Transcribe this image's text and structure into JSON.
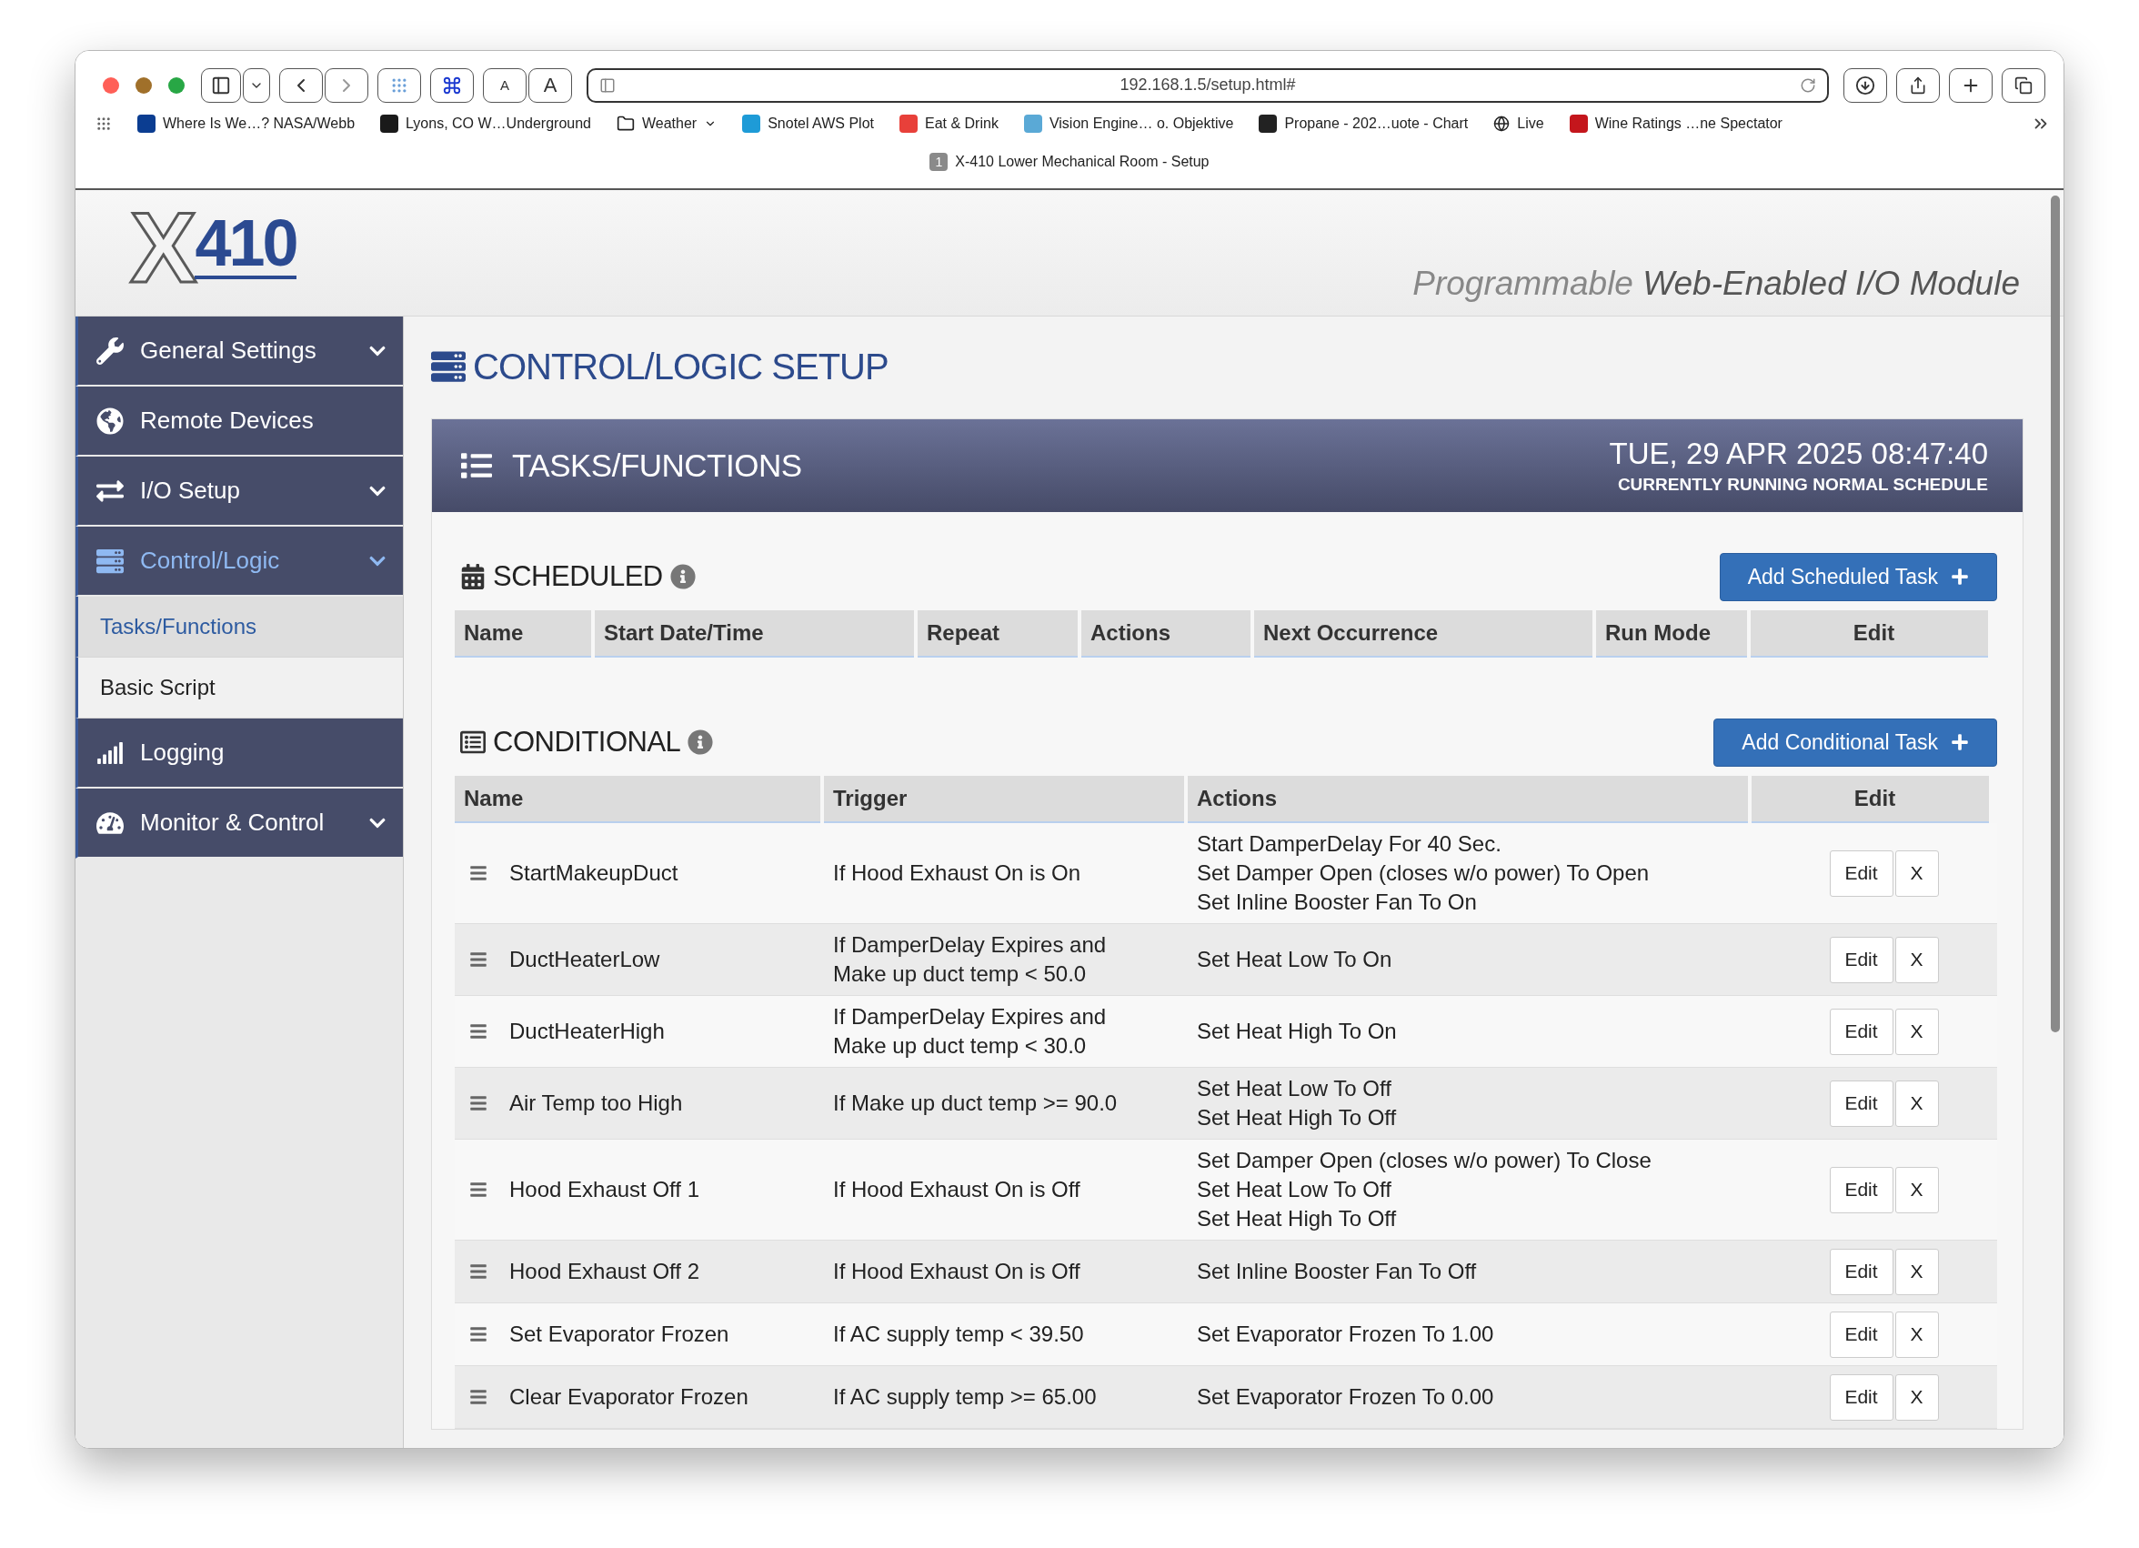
{
  "browser": {
    "text_size_buttons": [
      "A",
      "A"
    ],
    "url": "192.168.1.5/setup.html#",
    "bookmarks": [
      {
        "label": "Where Is We…? NASA/Webb",
        "kind": "link"
      },
      {
        "label": "Lyons, CO W…Underground",
        "kind": "link"
      },
      {
        "label": "Weather",
        "kind": "folder"
      },
      {
        "label": "Snotel AWS Plot",
        "kind": "link"
      },
      {
        "label": "Eat & Drink",
        "kind": "link"
      },
      {
        "label": "Vision Engine… o. Objektive",
        "kind": "link"
      },
      {
        "label": "Propane - 202…uote - Chart",
        "kind": "link"
      },
      {
        "label": "Live",
        "kind": "link"
      },
      {
        "label": "Wine Ratings …ne Spectator",
        "kind": "link"
      }
    ],
    "tab": {
      "number": "1",
      "title": "X-410 Lower Mechanical Room - Setup"
    }
  },
  "header": {
    "logo_letter": "X",
    "logo_number": "410",
    "tagline": "Programmable **Web-Enabled I/O Module**"
  },
  "sidebar": {
    "items": [
      {
        "label": "General Settings",
        "expandable": true,
        "selected": false
      },
      {
        "label": "Remote Devices",
        "expandable": false,
        "selected": false
      },
      {
        "label": "I/O Setup",
        "expandable": true,
        "selected": false
      },
      {
        "label": "Control/Logic",
        "expandable": true,
        "selected": true,
        "children": [
          {
            "label": "Tasks/Functions",
            "selected": true
          },
          {
            "label": "Basic Script",
            "selected": false
          }
        ]
      },
      {
        "label": "Logging",
        "expandable": false,
        "selected": false
      },
      {
        "label": "Monitor & Control",
        "expandable": true,
        "selected": false
      }
    ]
  },
  "page_title": "CONTROL/LOGIC SETUP",
  "panel": {
    "title": "TASKS/FUNCTIONS",
    "datetime": "TUE, 29 APR 2025 08:47:40",
    "status": "CURRENTLY RUNNING NORMAL SCHEDULE"
  },
  "scheduled": {
    "title": "SCHEDULED",
    "add_button": "Add Scheduled Task",
    "columns": [
      "Name",
      "Start Date/Time",
      "Repeat",
      "Actions",
      "Next Occurrence",
      "Run Mode",
      "Edit"
    ]
  },
  "conditional": {
    "title": "CONDITIONAL",
    "add_button": "Add Conditional Task",
    "columns": [
      "Name",
      "Trigger",
      "Actions",
      "Edit"
    ],
    "rows": [
      {
        "name": "StartMakeupDuct",
        "trigger": [
          "If Hood Exhaust On is On"
        ],
        "actions": [
          "Start DamperDelay For 40 Sec.",
          "Set Damper Open (closes w/o power) To Open",
          "Set Inline Booster Fan To On"
        ],
        "buttons": [
          "Edit",
          "X"
        ]
      },
      {
        "name": "DuctHeaterLow",
        "trigger": [
          "If DamperDelay Expires and",
          "Make up duct temp < 50.0"
        ],
        "actions": [
          "Set Heat Low To On"
        ],
        "buttons": [
          "Edit",
          "X"
        ]
      },
      {
        "name": "DuctHeaterHigh",
        "trigger": [
          "If DamperDelay Expires and",
          "Make up duct temp < 30.0"
        ],
        "actions": [
          "Set Heat High To On"
        ],
        "buttons": [
          "Edit",
          "X"
        ]
      },
      {
        "name": "Air Temp too High",
        "trigger": [
          "If Make up duct temp >= 90.0"
        ],
        "actions": [
          "Set Heat Low To Off",
          "Set Heat High To Off"
        ],
        "buttons": [
          "Edit",
          "X"
        ]
      },
      {
        "name": "Hood Exhaust Off 1",
        "trigger": [
          "If Hood Exhaust On is Off"
        ],
        "actions": [
          "Set Damper Open (closes w/o power) To Close",
          "Set Heat Low To Off",
          "Set Heat High To Off"
        ],
        "buttons": [
          "Edit",
          "X"
        ]
      },
      {
        "name": "Hood Exhaust Off 2",
        "trigger": [
          "If Hood Exhaust On is Off"
        ],
        "actions": [
          "Set Inline Booster Fan To Off"
        ],
        "buttons": [
          "Edit",
          "X"
        ]
      },
      {
        "name": "Set Evaporator Frozen",
        "trigger": [
          "If AC supply temp < 39.50"
        ],
        "actions": [
          "Set Evaporator Frozen To 1.00"
        ],
        "buttons": [
          "Edit",
          "X"
        ]
      },
      {
        "name": "Clear Evaporator Frozen",
        "trigger": [
          "If AC supply temp >= 65.00"
        ],
        "actions": [
          "Set Evaporator Frozen To 0.00"
        ],
        "buttons": [
          "Edit",
          "X"
        ]
      }
    ]
  }
}
